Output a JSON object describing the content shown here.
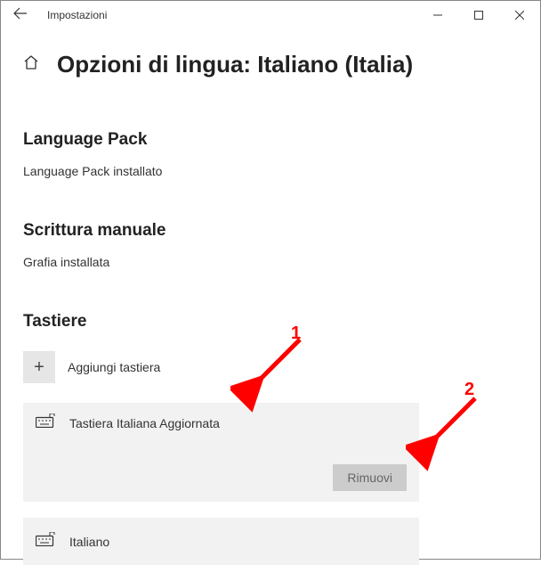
{
  "titlebar": {
    "app_title": "Impostazioni"
  },
  "page": {
    "title": "Opzioni di lingua: Italiano (Italia)"
  },
  "sections": {
    "language_pack": {
      "title": "Language Pack",
      "status": "Language Pack installato"
    },
    "handwriting": {
      "title": "Scrittura manuale",
      "status": "Grafia installata"
    },
    "keyboards": {
      "title": "Tastiere",
      "add_label": "Aggiungi tastiera"
    }
  },
  "keyboards": [
    {
      "name": "Tastiera Italiana Aggiornata",
      "remove_label": "Rimuovi",
      "expanded": true
    },
    {
      "name": "Italiano",
      "expanded": false
    }
  ],
  "annotations": {
    "a1": "1",
    "a2": "2"
  }
}
